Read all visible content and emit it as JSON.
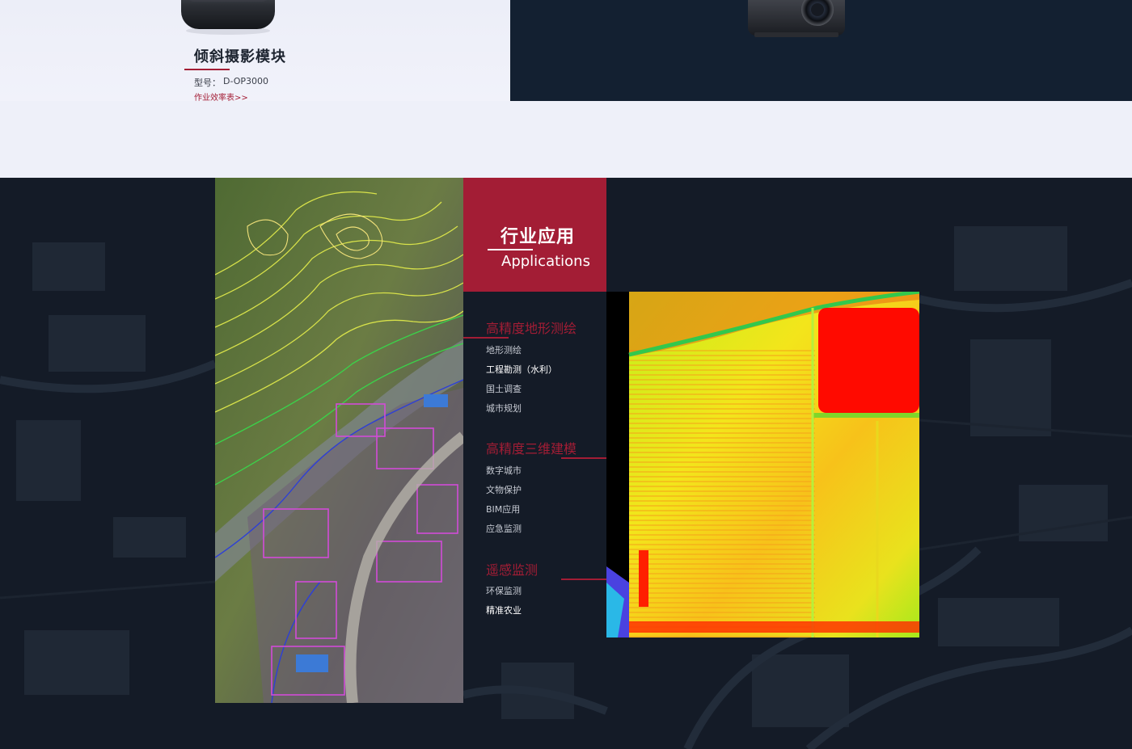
{
  "product": {
    "title": "倾斜摄影模块",
    "model_label": "型号：",
    "model_value": "D-OP3000",
    "link_text": "作业效率表>>"
  },
  "applications": {
    "heading_cn": "行业应用",
    "heading_en": "Applications",
    "categories": [
      {
        "title": "高精度地形测绘",
        "items": [
          "地形测绘",
          "工程勘测（水利）",
          "国土调查",
          "城市规划"
        ]
      },
      {
        "title": "高精度三维建模",
        "items": [
          "数字城市",
          "文物保护",
          "BIM应用",
          "应急监测"
        ]
      },
      {
        "title": "遥感监测",
        "items": [
          "环保监测",
          "精准农业"
        ]
      }
    ]
  },
  "colors": {
    "accent": "#a31d35",
    "dark_bg": "#141b27",
    "panel_dark": "#132031",
    "light_bg": "#eef0f9"
  }
}
